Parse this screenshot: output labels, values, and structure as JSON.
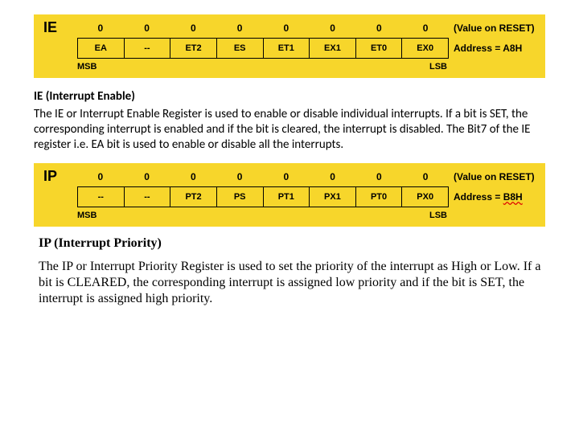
{
  "ie": {
    "label": "IE",
    "reset_values": [
      "0",
      "0",
      "0",
      "0",
      "0",
      "0",
      "0",
      "0"
    ],
    "reset_caption": "(Value on RESET)",
    "bits": [
      "EA",
      "--",
      "ET2",
      "ES",
      "ET1",
      "EX1",
      "ET0",
      "EX0"
    ],
    "address": "Address = A8H",
    "msb": "MSB",
    "lsb": "LSB"
  },
  "ie_section": {
    "title": "IE (Interrupt Enable)",
    "body": "The IE or Interrupt Enable Register is used to enable or disable individual interrupts. If a bit is SET, the corresponding interrupt is enabled and if the bit is cleared, the interrupt is disabled. The Bit7 of the IE register i.e. EA bit is used to enable or disable all the interrupts."
  },
  "ip": {
    "label": "IP",
    "reset_values": [
      "0",
      "0",
      "0",
      "0",
      "0",
      "0",
      "0",
      "0"
    ],
    "reset_caption": "(Value on RESET)",
    "bits": [
      "--",
      "--",
      "PT2",
      "PS",
      "PT1",
      "PX1",
      "PT0",
      "PX0"
    ],
    "address": "Address = B8H",
    "msb": "MSB",
    "lsb": "LSB"
  },
  "ip_section": {
    "title": "IP (Interrupt Priority)",
    "body": "The IP or Interrupt Priority Register is used to set the priority of the interrupt as High or Low. If a bit is CLEARED, the corresponding interrupt is assigned low priority and if the bit is SET, the interrupt is assigned high priority."
  }
}
